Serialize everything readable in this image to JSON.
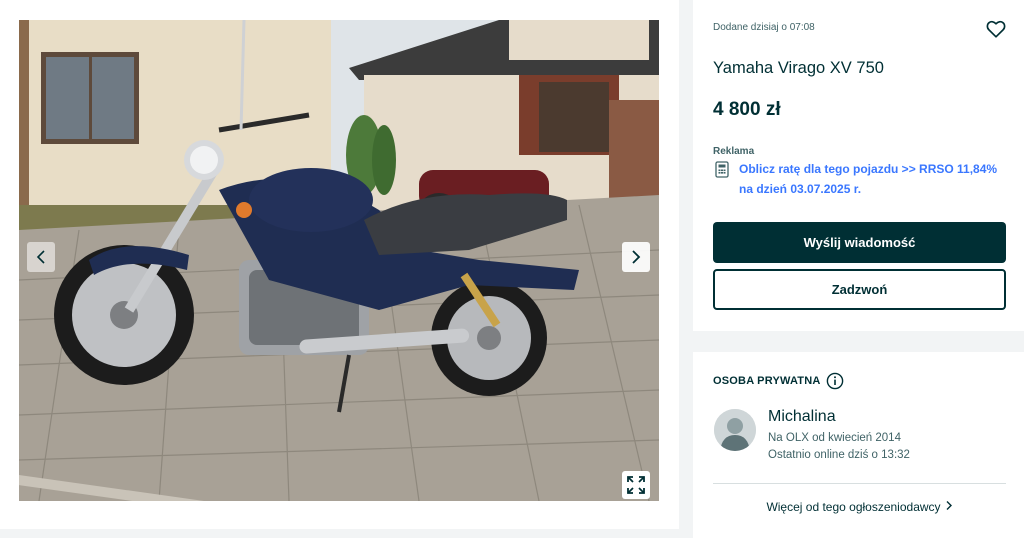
{
  "listing": {
    "added": "Dodane dzisiaj o 07:08",
    "title": "Yamaha Virago XV 750",
    "price": "4 800 zł",
    "ad_label": "Reklama",
    "promo_text": "Oblicz ratę dla tego pojazdu >> RRSO 11,84% na dzień 03.07.2025 r.",
    "send_message_label": "Wyślij wiadomość",
    "call_label": "Zadzwoń"
  },
  "seller": {
    "type_label": "OSOBA PRYWATNA",
    "name": "Michalina",
    "since": "Na OLX od kwiecień 2014",
    "online": "Ostatnio online dziś o 13:32",
    "more_link": "Więcej od tego ogłoszeniodawcy"
  },
  "icons": {
    "favorite": "heart-icon",
    "calculator": "calculator-icon",
    "info": "info-icon",
    "prev": "chevron-left-icon",
    "next": "chevron-right-icon",
    "fullscreen": "expand-icon"
  },
  "colors": {
    "primary": "#002f34",
    "link": "#3a77ff",
    "background": "#f2f4f5",
    "motorcycle_body": "#1f2d52"
  }
}
